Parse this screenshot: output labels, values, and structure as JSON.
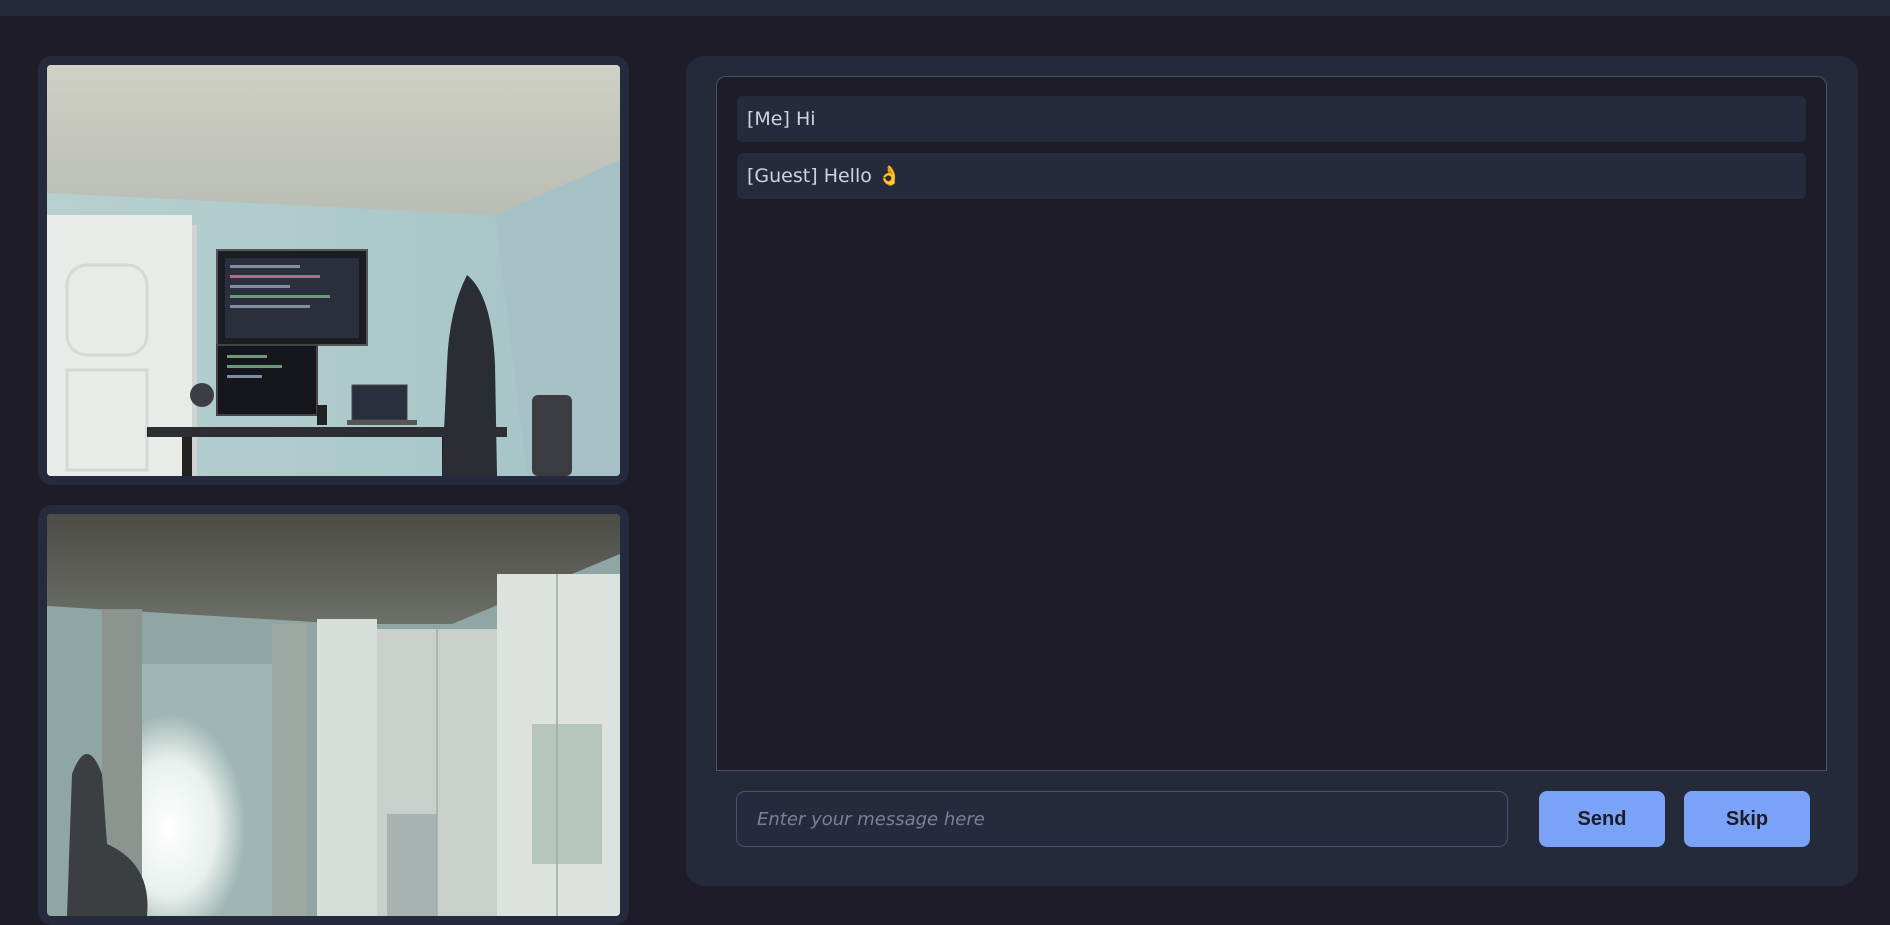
{
  "chat": {
    "messages": [
      {
        "sender": "[Me]",
        "text": "Hi",
        "emoji": ""
      },
      {
        "sender": "[Guest]",
        "text": "Hello",
        "emoji": "👌"
      }
    ],
    "input": {
      "placeholder": "Enter your message here",
      "value": ""
    },
    "send_label": "Send",
    "skip_label": "Skip"
  },
  "colors": {
    "background": "#1d1c27",
    "panel": "#252a3b",
    "accent": "#7aa2f7",
    "message_bg": "#262a3d"
  }
}
